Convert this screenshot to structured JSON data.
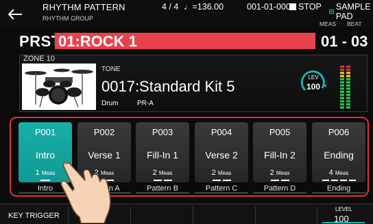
{
  "header": {
    "title": "RHYTHM PATTERN",
    "group_label": "RHYTHM GROUP",
    "time_signature": "4 / 4",
    "tempo": "♩=136.00",
    "position": "001-01-000",
    "transport": "STOP",
    "sample_pad": "SAMPLE PAD",
    "meas_label": "MEAS",
    "beat_label": "BEAT"
  },
  "pattern": {
    "prefix": "PRST",
    "name": "01:ROCK 1",
    "meas_beat": "01 - 03"
  },
  "zone": {
    "label": "ZONE 10",
    "tone_title": "TONE",
    "tone_name": "0017:Standard Kit 5",
    "category": "Drum",
    "bank": "PR-A",
    "lev_word": "LEV",
    "lev_value": "100"
  },
  "pads": [
    {
      "id": "P001",
      "name": "Intro",
      "meas_num": "1",
      "meas_unit": "Meas",
      "sub": "Intro",
      "bars": 1,
      "active": true
    },
    {
      "id": "P002",
      "name": "Verse 1",
      "meas_num": "2",
      "meas_unit": "Meas",
      "sub": "Pattern A",
      "bars": 2,
      "active": false
    },
    {
      "id": "P003",
      "name": "Fill-In 1",
      "meas_num": "2",
      "meas_unit": "Meas",
      "sub": "Pattern B",
      "bars": 2,
      "active": false
    },
    {
      "id": "P004",
      "name": "Verse 2",
      "meas_num": "2",
      "meas_unit": "Meas",
      "sub": "Pattern C",
      "bars": 2,
      "active": false
    },
    {
      "id": "P005",
      "name": "Fill-In 2",
      "meas_num": "2",
      "meas_unit": "Meas",
      "sub": "Pattern D",
      "bars": 2,
      "active": false
    },
    {
      "id": "P006",
      "name": "Ending",
      "meas_num": "4",
      "meas_unit": "Meas",
      "sub": "Ending",
      "bars": 4,
      "active": false
    }
  ],
  "footer": {
    "key_trigger": "KEY TRIGGER",
    "level_word": "LEVEL",
    "level_value": "100"
  },
  "colors": {
    "accent_red": "#e8424d",
    "active_pad": "#18b0a8",
    "cyan": "#19b3b0"
  }
}
